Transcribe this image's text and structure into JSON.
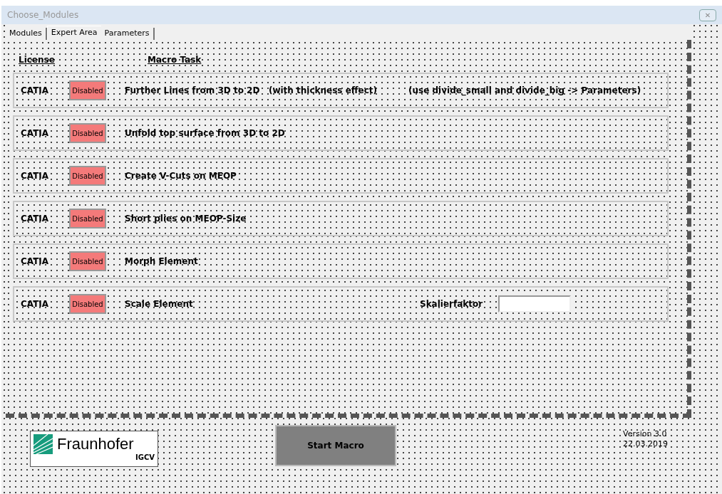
{
  "window": {
    "title": "Choose_Modules",
    "close": "✕"
  },
  "tabs": [
    {
      "label": "Modules",
      "selected": false
    },
    {
      "label": "Expert Area",
      "selected": true
    },
    {
      "label": "Parameters",
      "selected": false
    }
  ],
  "headers": {
    "license": "License",
    "task": "Macro Task"
  },
  "rows": [
    {
      "kind": "note",
      "license": "CATIA",
      "status": "Disabled",
      "enabled": false,
      "task": "Further Lines from 3D to 2D   (with thickness effect)",
      "note": "(use divide_small and divide_big -> Parameters)"
    },
    {
      "kind": "plain",
      "license": "CATIA",
      "status": "Disabled",
      "enabled": false,
      "task": "Unfold top surface from 3D to 2D"
    },
    {
      "kind": "plain",
      "license": "CATIA",
      "status": "Disabled",
      "enabled": false,
      "task": "Create V-Cuts on MEOP"
    },
    {
      "kind": "plain",
      "license": "CATIA",
      "status": "Disabled",
      "enabled": false,
      "task": "Short plies on MEOP-Size"
    },
    {
      "kind": "plain",
      "license": "CATIA",
      "status": "Disabled",
      "enabled": false,
      "task": "Morph Element"
    },
    {
      "kind": "field",
      "license": "CATIA",
      "status": "Disabled",
      "enabled": false,
      "task": "Scale Element",
      "field_label": "Skalierfaktor"
    }
  ],
  "logo": {
    "name": "Fraunhofer",
    "unit": "IGCV"
  },
  "start_button": "Start Macro",
  "version": {
    "number": "Version 3.0",
    "date": "22.03.2019"
  }
}
